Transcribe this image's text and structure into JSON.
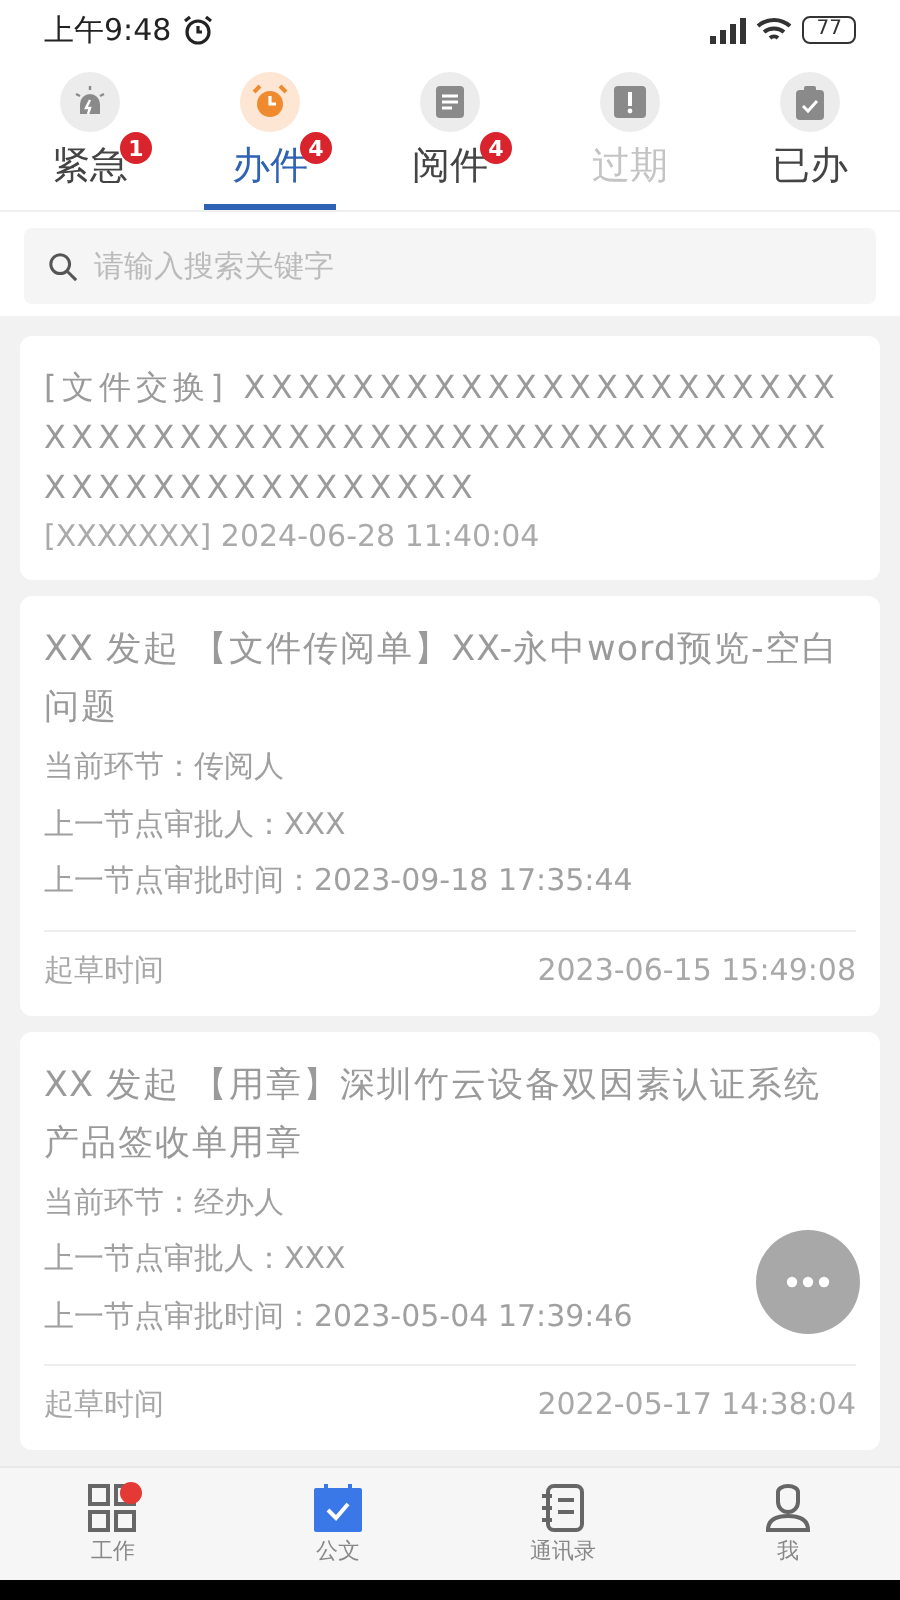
{
  "status_bar": {
    "time": "上午9:48",
    "battery": "77"
  },
  "tabs": [
    {
      "label": "紧急",
      "badge": "1",
      "selected": false,
      "disabled": false
    },
    {
      "label": "办件",
      "badge": "4",
      "selected": true,
      "disabled": false
    },
    {
      "label": "阅件",
      "badge": "4",
      "selected": false,
      "disabled": false
    },
    {
      "label": "过期",
      "selected": false,
      "disabled": true
    },
    {
      "label": "已办",
      "selected": false,
      "disabled": false
    }
  ],
  "search": {
    "placeholder": "请输入搜索关键字"
  },
  "cards": [
    {
      "kind": "exchange",
      "title": "[文件交换] XXXXXXXXXXXXXXXXXXXXXXXXXXXXXXXXXXXXXXXXXXXXXXXXXXXXXXXXXXXXXXXXXXX",
      "meta": "[XXXXXXX] 2024-06-28 11:40:04"
    },
    {
      "kind": "flow",
      "title": "XX 发起 【文件传阅单】XX-永中word预览-空白问题",
      "fields": [
        "当前环节：传阅人",
        "上一节点审批人：XXX",
        "上一节点审批时间：2023-09-18 17:35:44"
      ],
      "footer_label": "起草时间",
      "footer_value": "2023-06-15 15:49:08"
    },
    {
      "kind": "flow",
      "title": "XX 发起 【用章】深圳竹云设备双因素认证系统产品签收单用章",
      "fields": [
        "当前环节：经办人",
        "上一节点审批人：XXX",
        "上一节点审批时间：2023-05-04 17:39:46"
      ],
      "footer_label": "起草时间",
      "footer_value": "2022-05-17 14:38:04"
    }
  ],
  "bottom_nav": [
    {
      "label": "工作",
      "selected": false,
      "dot": true
    },
    {
      "label": "公文",
      "selected": true,
      "dot": false
    },
    {
      "label": "通讯录",
      "selected": false,
      "dot": false
    },
    {
      "label": "我",
      "selected": false,
      "dot": false
    }
  ]
}
